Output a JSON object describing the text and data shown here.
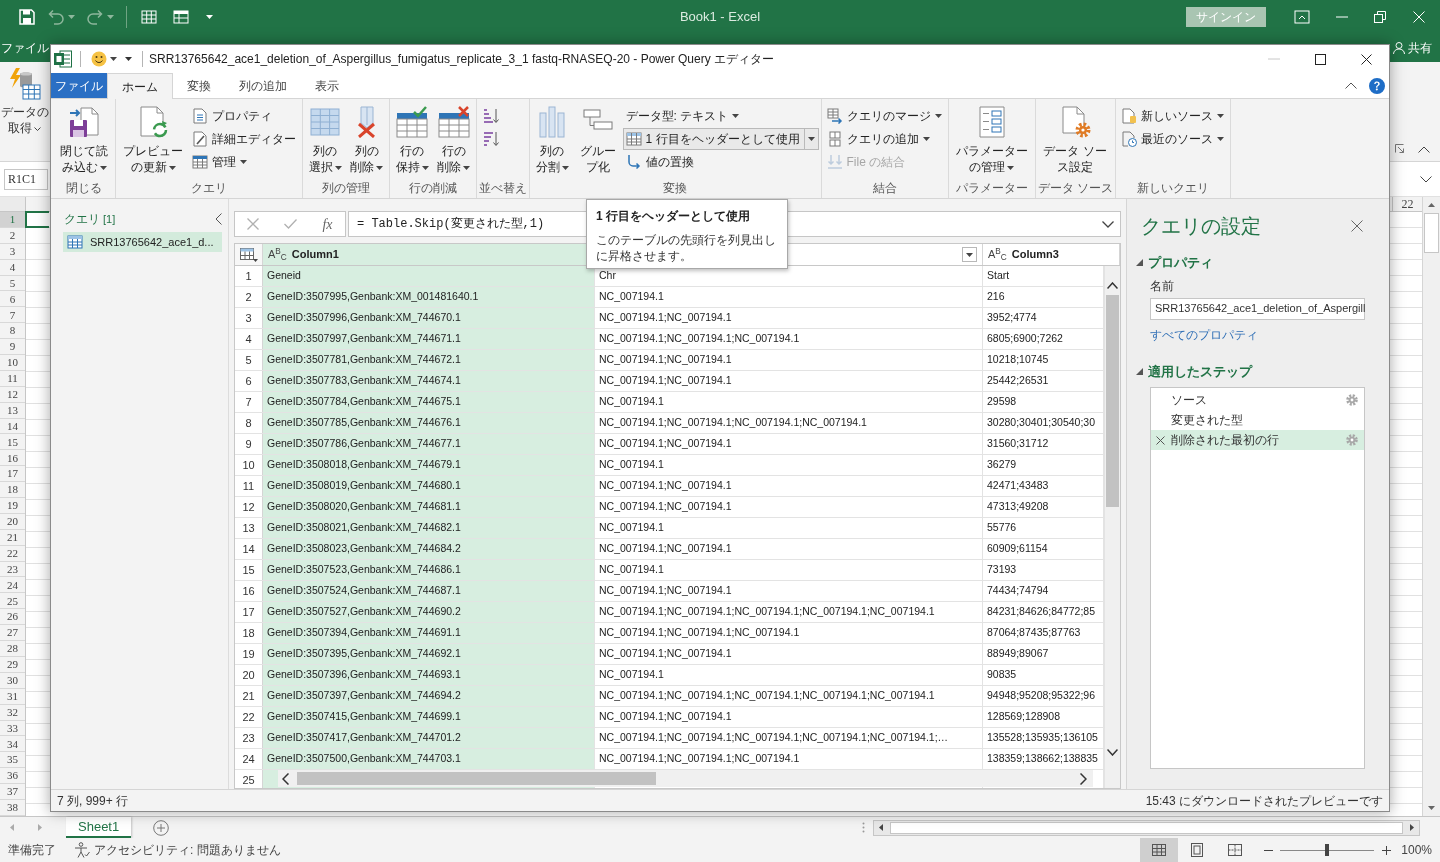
{
  "excel": {
    "title": "Book1 - Excel",
    "sign_in": "サインイン",
    "file_tab": "ファイル",
    "share": "共有",
    "get_data": {
      "label": "データの取得",
      "dropdown": true
    },
    "name_box": "R1C1",
    "column_header": "22",
    "rows": [
      {
        "label": "1",
        "selected": true
      },
      {
        "label": "2",
        "selected": false
      },
      {
        "label": "3",
        "selected": false
      },
      {
        "label": "4",
        "selected": false
      },
      {
        "label": "5",
        "selected": false
      },
      {
        "label": "6",
        "selected": false
      },
      {
        "label": "7",
        "selected": false
      },
      {
        "label": "8",
        "selected": false
      },
      {
        "label": "9",
        "selected": false
      },
      {
        "label": "10",
        "selected": false
      },
      {
        "label": "11",
        "selected": false
      },
      {
        "label": "12",
        "selected": false
      },
      {
        "label": "13",
        "selected": false
      },
      {
        "label": "14",
        "selected": false
      },
      {
        "label": "15",
        "selected": false
      },
      {
        "label": "16",
        "selected": false
      },
      {
        "label": "17",
        "selected": false
      },
      {
        "label": "18",
        "selected": false
      },
      {
        "label": "19",
        "selected": false
      },
      {
        "label": "20",
        "selected": false
      },
      {
        "label": "21",
        "selected": false
      },
      {
        "label": "22",
        "selected": false
      },
      {
        "label": "23",
        "selected": false
      },
      {
        "label": "24",
        "selected": false
      },
      {
        "label": "25",
        "selected": false
      },
      {
        "label": "26",
        "selected": false
      },
      {
        "label": "27",
        "selected": false
      },
      {
        "label": "28",
        "selected": false
      },
      {
        "label": "29",
        "selected": false
      },
      {
        "label": "30",
        "selected": false
      },
      {
        "label": "31",
        "selected": false
      },
      {
        "label": "32",
        "selected": false
      },
      {
        "label": "33",
        "selected": false
      },
      {
        "label": "34",
        "selected": false
      },
      {
        "label": "35",
        "selected": false
      },
      {
        "label": "36",
        "selected": false
      },
      {
        "label": "37",
        "selected": false
      },
      {
        "label": "38",
        "selected": false
      }
    ],
    "sheet_tabs": [
      {
        "label": "Sheet1",
        "selected": true
      }
    ],
    "status": "準備完了",
    "accessibility": "アクセシビリティ: 問題ありません",
    "views": [
      {
        "kind": "normal",
        "selected": true
      },
      {
        "kind": "page_layout",
        "selected": false
      },
      {
        "kind": "page_break",
        "selected": false
      }
    ],
    "zoom": {
      "level": 0.5,
      "reading": "100%"
    }
  },
  "editor": {
    "title": "SRR13765642_ace1_deletion_of_Aspergillus_fumigatus_replicate_3_1 fastq-RNASEQ-20 - Power Query エディター",
    "tabs": [
      {
        "label": "ファイル",
        "kind": "file",
        "selected": false
      },
      {
        "label": "ホーム",
        "kind": "tab",
        "selected": true
      },
      {
        "label": "変換",
        "kind": "tab",
        "selected": false
      },
      {
        "label": "列の追加",
        "kind": "tab",
        "selected": false
      },
      {
        "label": "表示",
        "kind": "tab",
        "selected": false
      }
    ],
    "ribbon_groups": [
      {
        "label": "閉じる",
        "buttons": [
          {
            "kind": "large",
            "label": "閉じて読み込む",
            "dropdown": true
          }
        ]
      },
      {
        "label": "クエリ",
        "buttons": [
          {
            "kind": "large",
            "label": "プレビューの更新",
            "dropdown": true
          },
          {
            "kind": "stack",
            "entries": [
              {
                "kind": "labeled",
                "label": "プロパティ",
                "dropdown": false
              },
              {
                "kind": "labeled",
                "label": "詳細エディター",
                "dropdown": false
              },
              {
                "kind": "labeled",
                "label": "管理",
                "dropdown": true
              }
            ]
          }
        ]
      },
      {
        "label": "列の管理",
        "buttons": [
          {
            "kind": "large",
            "label": "列の選択",
            "dropdown": true
          },
          {
            "kind": "large",
            "label": "列の削除",
            "dropdown": true
          }
        ]
      },
      {
        "label": "行の削減",
        "buttons": [
          {
            "kind": "large",
            "label": "行の保持",
            "dropdown": true
          },
          {
            "kind": "large",
            "label": "行の削除",
            "dropdown": true
          }
        ]
      },
      {
        "label": "並べ替え",
        "buttons": [
          {
            "kind": "stack",
            "entries": [
              {
                "kind": "icon_only"
              },
              {
                "kind": "icon_only"
              }
            ]
          }
        ]
      },
      {
        "label": "変換",
        "buttons": [
          {
            "kind": "large",
            "label": "列の分割",
            "dropdown": true
          },
          {
            "kind": "large",
            "label": "グループ化",
            "dropdown": false
          },
          {
            "kind": "stack",
            "entries": [
              {
                "kind": "labeled",
                "label": "データ型: テキスト",
                "dropdown": true,
                "hovered": false
              },
              {
                "kind": "split",
                "label": "1 行目をヘッダーとして使用",
                "dropdown": true,
                "hovered": true
              },
              {
                "kind": "labeled",
                "label": "値の置換",
                "dropdown": false,
                "hovered": false
              }
            ]
          }
        ]
      },
      {
        "label": "結合",
        "buttons": [
          {
            "kind": "stack",
            "entries": [
              {
                "kind": "labeled",
                "label": "クエリのマージ",
                "dropdown": true,
                "disabled": false
              },
              {
                "kind": "labeled",
                "label": "クエリの追加",
                "dropdown": true,
                "disabled": false
              },
              {
                "kind": "labeled",
                "label": "File の結合",
                "dropdown": false,
                "disabled": true
              }
            ]
          }
        ]
      },
      {
        "label": "パラメーター",
        "buttons": [
          {
            "kind": "large",
            "label": "パラメーターの管理",
            "dropdown": true
          }
        ]
      },
      {
        "label": "データ ソース",
        "buttons": [
          {
            "kind": "large",
            "label": "データ ソース設定",
            "dropdown": false
          }
        ]
      },
      {
        "label": "新しいクエリ",
        "buttons": [
          {
            "kind": "stack",
            "entries": [
              {
                "kind": "labeled",
                "label": "新しいソース",
                "dropdown": true
              },
              {
                "kind": "labeled",
                "label": "最近のソース",
                "dropdown": true
              }
            ]
          }
        ]
      }
    ],
    "queries": {
      "title": "クエリ",
      "count": "[1]",
      "items": [
        {
          "label": "SRR13765642_ace1_d...",
          "selected": true
        }
      ]
    },
    "formula_bar": {
      "function_label": "fx",
      "formula": "= Table.Skip(変更された型,1)"
    },
    "tooltip": {
      "title": "1 行目をヘッダーとして使用",
      "description": "このテーブルの先頭行を列見出しに昇格させます。"
    },
    "table": {
      "columns": [
        {
          "type": "A$^{B}$$_{C}$",
          "label": "Column1",
          "selected": true
        },
        {
          "dropdown": true,
          "selected": false
        },
        {
          "type": "A$^{B}$$_{C}$",
          "label": "Column3",
          "selected": false
        }
      ],
      "rows": [
        {
          "number": "1",
          "cells": [
            "Geneid",
            "Chr",
            "Start"
          ]
        },
        {
          "number": "2",
          "cells": [
            "GeneID:3507995,Genbank:XM_001481640.1",
            "NC_007194.1",
            "216"
          ]
        },
        {
          "number": "3",
          "cells": [
            "GeneID:3507996,Genbank:XM_744670.1",
            "NC_007194.1;NC_007194.1",
            "3952;4774"
          ]
        },
        {
          "number": "4",
          "cells": [
            "GeneID:3507997,Genbank:XM_744671.1",
            "NC_007194.1;NC_007194.1;NC_007194.1",
            "6805;6900;7262"
          ]
        },
        {
          "number": "5",
          "cells": [
            "GeneID:3507781,Genbank:XM_744672.1",
            "NC_007194.1;NC_007194.1",
            "10218;10745"
          ]
        },
        {
          "number": "6",
          "cells": [
            "GeneID:3507783,Genbank:XM_744674.1",
            "NC_007194.1;NC_007194.1",
            "25442;26531"
          ]
        },
        {
          "number": "7",
          "cells": [
            "GeneID:3507784,Genbank:XM_744675.1",
            "NC_007194.1",
            "29598"
          ]
        },
        {
          "number": "8",
          "cells": [
            "GeneID:3507785,Genbank:XM_744676.1",
            "NC_007194.1;NC_007194.1;NC_007194.1;NC_007194.1",
            "30280;30401;30540;30"
          ]
        },
        {
          "number": "9",
          "cells": [
            "GeneID:3507786,Genbank:XM_744677.1",
            "NC_007194.1;NC_007194.1",
            "31560;31712"
          ]
        },
        {
          "number": "10",
          "cells": [
            "GeneID:3508018,Genbank:XM_744679.1",
            "NC_007194.1",
            "36279"
          ]
        },
        {
          "number": "11",
          "cells": [
            "GeneID:3508019,Genbank:XM_744680.1",
            "NC_007194.1;NC_007194.1",
            "42471;43483"
          ]
        },
        {
          "number": "12",
          "cells": [
            "GeneID:3508020,Genbank:XM_744681.1",
            "NC_007194.1;NC_007194.1",
            "47313;49208"
          ]
        },
        {
          "number": "13",
          "cells": [
            "GeneID:3508021,Genbank:XM_744682.1",
            "NC_007194.1",
            "55776"
          ]
        },
        {
          "number": "14",
          "cells": [
            "GeneID:3508023,Genbank:XM_744684.2",
            "NC_007194.1;NC_007194.1",
            "60909;61154"
          ]
        },
        {
          "number": "15",
          "cells": [
            "GeneID:3507523,Genbank:XM_744686.1",
            "NC_007194.1",
            "73193"
          ]
        },
        {
          "number": "16",
          "cells": [
            "GeneID:3507524,Genbank:XM_744687.1",
            "NC_007194.1;NC_007194.1",
            "74434;74794"
          ]
        },
        {
          "number": "17",
          "cells": [
            "GeneID:3507527,Genbank:XM_744690.2",
            "NC_007194.1;NC_007194.1;NC_007194.1;NC_007194.1;NC_007194.1",
            "84231;84626;84772;85"
          ]
        },
        {
          "number": "18",
          "cells": [
            "GeneID:3507394,Genbank:XM_744691.1",
            "NC_007194.1;NC_007194.1;NC_007194.1",
            "87064;87435;87763"
          ]
        },
        {
          "number": "19",
          "cells": [
            "GeneID:3507395,Genbank:XM_744692.1",
            "NC_007194.1;NC_007194.1",
            "88949;89067"
          ]
        },
        {
          "number": "20",
          "cells": [
            "GeneID:3507396,Genbank:XM_744693.1",
            "NC_007194.1",
            "90835"
          ]
        },
        {
          "number": "21",
          "cells": [
            "GeneID:3507397,Genbank:XM_744694.2",
            "NC_007194.1;NC_007194.1;NC_007194.1;NC_007194.1;NC_007194.1",
            "94948;95208;95322;96"
          ]
        },
        {
          "number": "22",
          "cells": [
            "GeneID:3507415,Genbank:XM_744699.1",
            "NC_007194.1;NC_007194.1",
            "128569;128908"
          ]
        },
        {
          "number": "23",
          "cells": [
            "GeneID:3507417,Genbank:XM_744701.2",
            "NC_007194.1;NC_007194.1;NC_007194.1;NC_007194.1;NC_007194.1;…",
            "135528;135935;136105"
          ]
        },
        {
          "number": "24",
          "cells": [
            "GeneID:3507500,Genbank:XM_744703.1",
            "NC_007194.1;NC_007194.1;NC_007194.1",
            "138359;138662;138835"
          ]
        },
        {
          "number": "25"
        }
      ]
    },
    "settings": {
      "title": "クエリの設定",
      "properties": {
        "heading": "プロパティ",
        "expanded": true,
        "name_label": "名前",
        "name_value": "SRR13765642_ace1_deletion_of_Aspergill",
        "link": "すべてのプロパティ"
      },
      "steps_section": {
        "heading": "適用したステップ",
        "expanded": true,
        "steps": [
          {
            "label": "ソース",
            "selected": false,
            "settings": true
          },
          {
            "label": "変更された型",
            "selected": false,
            "settings": false
          },
          {
            "label": "削除された最初の行",
            "selected": true,
            "settings": true
          }
        ]
      }
    },
    "status_bar": {
      "summary": "7 列, 999+ 行",
      "preview_info": "15:43 にダウンロードされたプレビューです"
    }
  }
}
